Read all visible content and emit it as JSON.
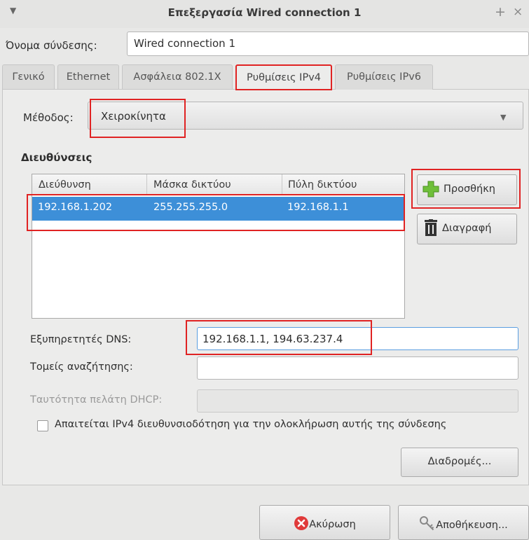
{
  "window": {
    "title": "Επεξεργασία Wired connection 1",
    "menu_icon": "chevron-down-icon",
    "plus_glyph": "+",
    "close_glyph": "×"
  },
  "connection": {
    "name_label": "Όνομα σύνδεσης:",
    "name_value": "Wired connection 1"
  },
  "tabs": [
    {
      "label": "Γενικό"
    },
    {
      "label": "Ethernet"
    },
    {
      "label": "Ασφάλεια 802.1X"
    },
    {
      "label": "Ρυθμίσεις IPv4"
    },
    {
      "label": "Ρυθμίσεις IPv6"
    }
  ],
  "active_tab": "Ρυθμίσεις IPv4",
  "ipv4": {
    "method_label": "Μέθοδος:",
    "method_value": "Χειροκίνητα",
    "addresses_heading": "Διευθύνσεις",
    "columns": [
      "Διεύθυνση",
      "Μάσκα δικτύου",
      "Πύλη δικτύου"
    ],
    "rows": [
      {
        "address": "192.168.1.202",
        "netmask": "255.255.255.0",
        "gateway": "192.168.1.1"
      }
    ],
    "add_label": "Προσθήκη",
    "delete_label": "Διαγραφή",
    "dns_label": "Εξυπηρετητές DNS:",
    "dns_value": "192.168.1.1, 194.63.237.4",
    "search_label": "Τομείς αναζήτησης:",
    "search_value": "",
    "dhcp_label": "Ταυτότητα πελάτη DHCP:",
    "dhcp_value": "",
    "require_label": "Απαιτείται IPv4 διευθυνσιοδότηση για την ολοκλήρωση αυτής της σύνδεσης",
    "require_checked": false,
    "routes_label": "Διαδρομές..."
  },
  "footer": {
    "cancel_label": "Ακύρωση",
    "save_label": "Αποθήκευση..."
  },
  "colors": {
    "selection": "#3d8fd8",
    "highlight": "#e02323",
    "add_icon": "#6fbf3a",
    "cancel_icon": "#e03a3a"
  }
}
